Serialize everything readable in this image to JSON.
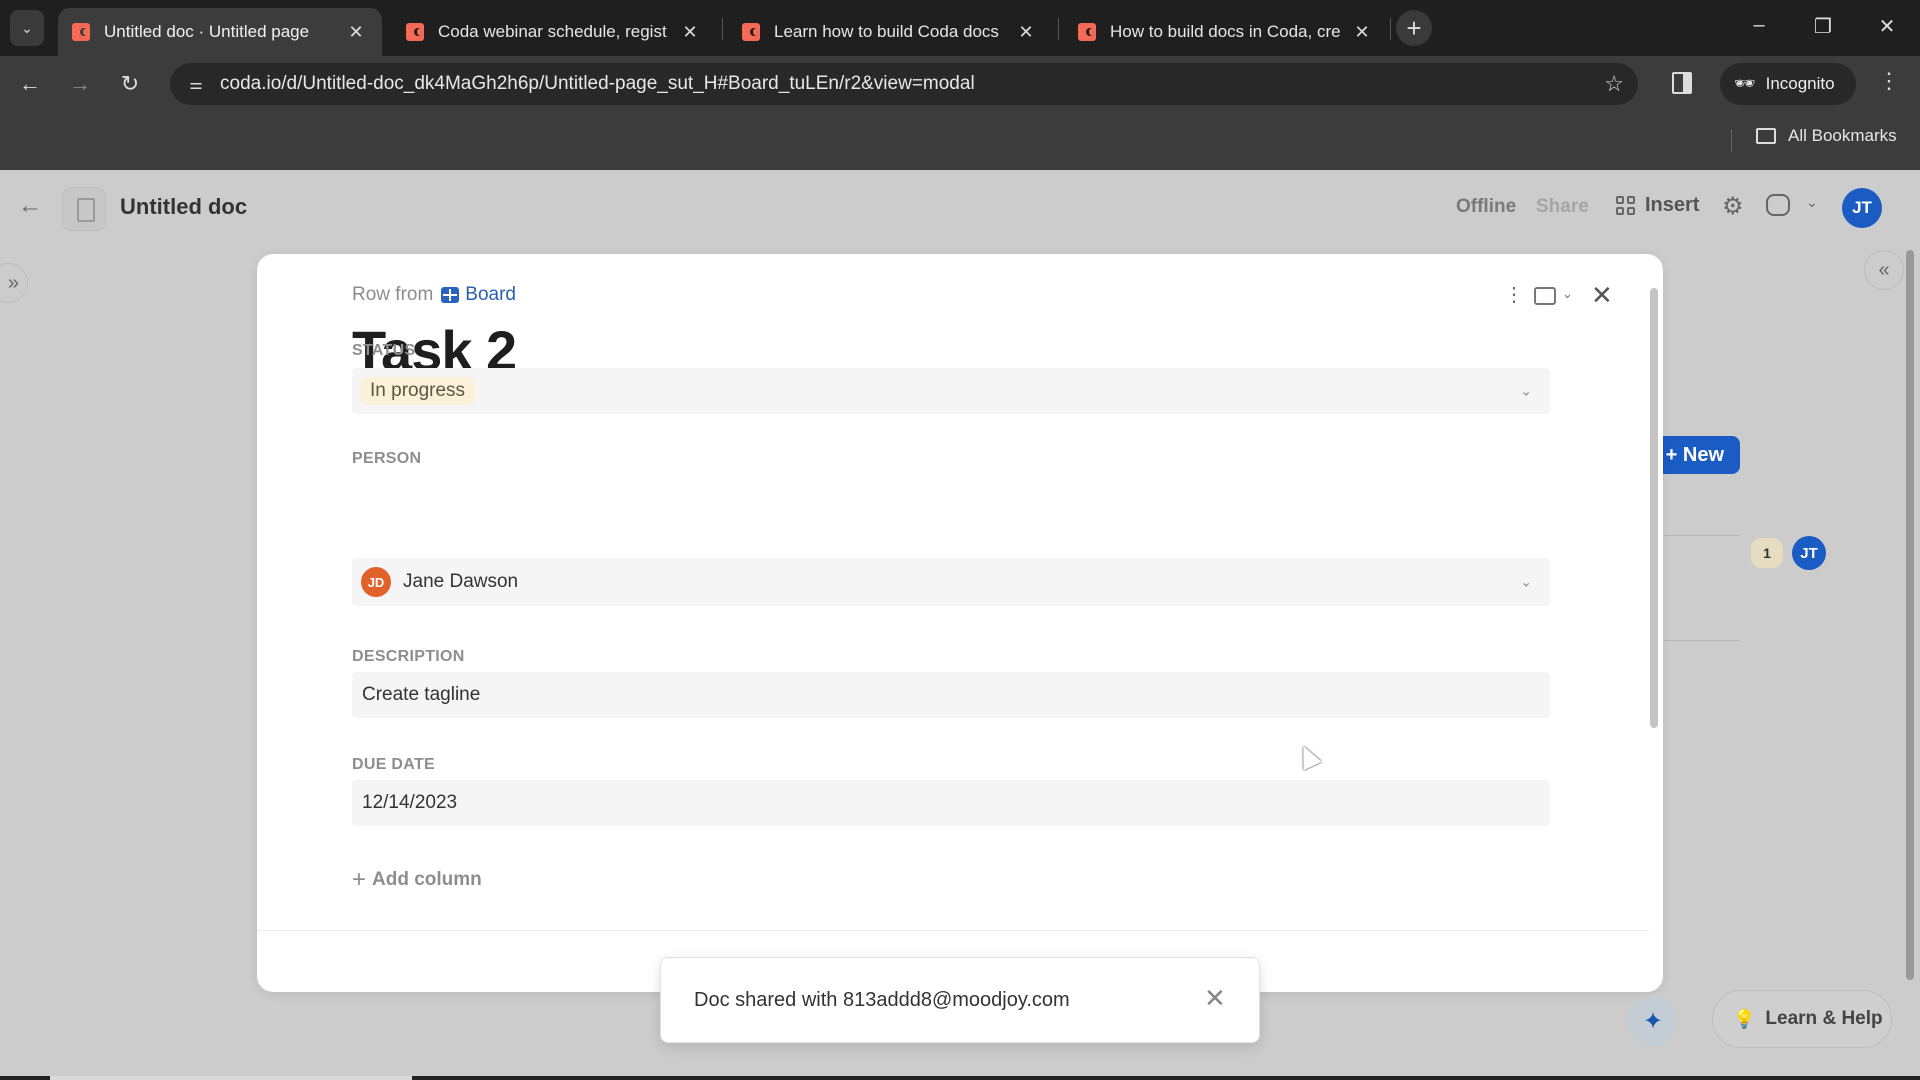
{
  "browser": {
    "tabs": [
      {
        "title": "Untitled doc · Untitled page",
        "active": true
      },
      {
        "title": "Coda webinar schedule, regist",
        "active": false
      },
      {
        "title": "Learn how to build Coda docs",
        "active": false
      },
      {
        "title": "How to build docs in Coda, cre",
        "active": false
      }
    ],
    "url": "coda.io/d/Untitled-doc_dk4MaGh2h6p/Untitled-page_sut_H#Board_tuLEn/r2&view=modal",
    "incognito_label": "Incognito",
    "bookmarks_label": "All Bookmarks",
    "icons": {
      "tab_search": "chevron-down-icon",
      "close_tab": "close-icon",
      "new_tab": "plus-icon",
      "back": "arrow-left-icon",
      "forward": "arrow-right-icon",
      "reload": "reload-icon",
      "site_info": "tune-icon",
      "bookmark_star": "star-icon",
      "side_panel": "side-panel-icon",
      "incognito": "incognito-icon",
      "menu": "kebab-icon",
      "folder": "folder-icon"
    }
  },
  "header": {
    "doc_title": "Untitled doc",
    "offline_label": "Offline",
    "share_label": "Share",
    "insert_label": "Insert",
    "avatar_initials": "JT"
  },
  "background": {
    "new_button_label": "+ New",
    "comment_count": "1",
    "avatar_initials": "JT"
  },
  "modal": {
    "row_from_prefix": "Row from",
    "row_from_table": "Board",
    "title": "Task 2",
    "fields": {
      "status": {
        "label": "STATUS",
        "value": "In progress",
        "color": "#fbf1d8"
      },
      "person": {
        "label": "PERSON",
        "initials": "JD",
        "value": "Jane Dawson",
        "avatar_color": "#e0622a"
      },
      "description": {
        "label": "DESCRIPTION",
        "value": "Create tagline"
      },
      "due_date": {
        "label": "DUE DATE",
        "value": "12/14/2023"
      }
    },
    "add_column_label": "Add column"
  },
  "toast": {
    "message": "Doc shared with 813addd8@moodjoy.com"
  },
  "footer": {
    "learn_help_label": "Learn & Help"
  },
  "colors": {
    "brand_blue": "#1a5bc4",
    "coda_red": "#f46a54"
  }
}
